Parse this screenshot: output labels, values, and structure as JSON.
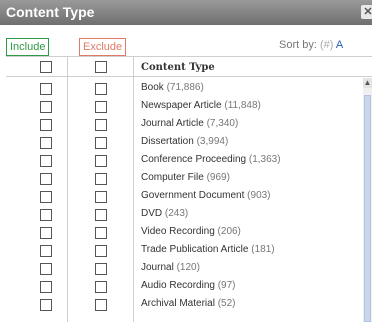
{
  "panel": {
    "title": "Content Type",
    "close_glyph": "✕"
  },
  "filters": {
    "include_label": "Include",
    "exclude_label": "Exclude",
    "sort_label": "Sort by:",
    "sort_radio_glyph": "(#)",
    "sort_value": "A"
  },
  "table": {
    "header_label": "Content Type",
    "rows": [
      {
        "label": "Book",
        "count": "(71,886)"
      },
      {
        "label": "Newspaper Article",
        "count": "(11,848)"
      },
      {
        "label": "Journal Article",
        "count": "(7,340)"
      },
      {
        "label": "Dissertation",
        "count": "(3,994)"
      },
      {
        "label": "Conference Proceeding",
        "count": "(1,363)"
      },
      {
        "label": "Computer File",
        "count": "(969)"
      },
      {
        "label": "Government Document",
        "count": "(903)"
      },
      {
        "label": "DVD",
        "count": "(243)"
      },
      {
        "label": "Video Recording",
        "count": "(206)"
      },
      {
        "label": "Trade Publication Article",
        "count": "(181)"
      },
      {
        "label": "Journal",
        "count": "(120)"
      },
      {
        "label": "Audio Recording",
        "count": "(97)"
      },
      {
        "label": "Archival Material",
        "count": "(52)"
      }
    ]
  },
  "scrollbar": {
    "up_glyph": "▲"
  },
  "colors": {
    "include": "#2e9a46",
    "exclude": "#e07a66",
    "titlebar": "#7d7d7d",
    "sort_link": "#2a5db0"
  }
}
